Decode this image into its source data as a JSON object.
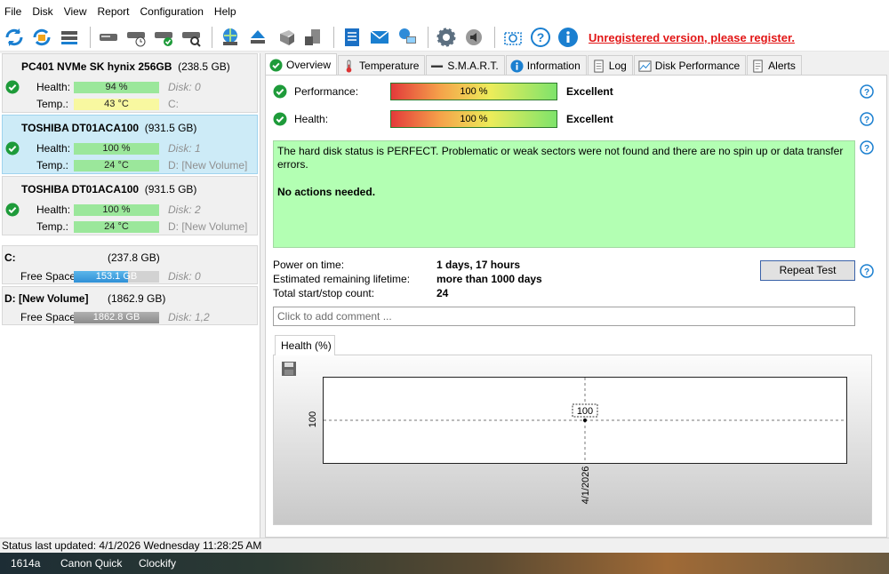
{
  "menu": [
    "File",
    "Disk",
    "View",
    "Report",
    "Configuration",
    "Help"
  ],
  "register_link": "Unregistered version, please register.",
  "disks": [
    {
      "name": "PC401 NVMe SK hynix 256GB",
      "size": "(238.5 GB)",
      "health": "94 %",
      "health_pct": 94,
      "temp": "43 °C",
      "temp_pct": 100,
      "disk_no": "Disk: 0",
      "drive": "C:",
      "selected": false
    },
    {
      "name": "TOSHIBA DT01ACA100",
      "size": "(931.5 GB)",
      "health": "100 %",
      "health_pct": 100,
      "temp": "24 °C",
      "temp_pct": 100,
      "disk_no": "Disk: 1",
      "drive": "D: [New Volume]",
      "selected": true
    },
    {
      "name": "TOSHIBA DT01ACA100",
      "size": "(931.5 GB)",
      "health": "100 %",
      "health_pct": 100,
      "temp": "24 °C",
      "temp_pct": 100,
      "disk_no": "Disk: 2",
      "drive": "D: [New Volume]",
      "selected": false
    }
  ],
  "disk_labels": {
    "health": "Health:",
    "temp": "Temp.:"
  },
  "partitions": [
    {
      "name": "C:",
      "size": "(237.8 GB)",
      "free_label": "Free Space",
      "free": "153.1 GB",
      "free_pct": 64,
      "disk": "Disk: 0"
    },
    {
      "name": "D: [New Volume]",
      "size": "(1862.9 GB)",
      "free_label": "Free Space",
      "free": "1862.8 GB",
      "free_pct": 100,
      "disk": "Disk: 1,2"
    }
  ],
  "tabs": [
    "Overview",
    "Temperature",
    "S.M.A.R.T.",
    "Information",
    "Log",
    "Disk Performance",
    "Alerts"
  ],
  "overview": {
    "performance_label": "Performance:",
    "performance_value": "100 %",
    "performance_verdict": "Excellent",
    "health_label": "Health:",
    "health_value": "100 %",
    "health_verdict": "Excellent",
    "status_text": "The hard disk status is PERFECT. Problematic or weak sectors were not found and there are no spin up or data transfer errors.",
    "actions_text": "No actions needed.",
    "power_on_label": "Power on time:",
    "power_on_value": "1 days, 17 hours",
    "lifetime_label": "Estimated remaining lifetime:",
    "lifetime_value": "more than 1000 days",
    "startstop_label": "Total start/stop count:",
    "startstop_value": "24",
    "repeat_button": "Repeat Test",
    "comment_placeholder": "Click to add comment ..."
  },
  "chart_tab": "Health (%)",
  "chart_data": {
    "type": "line",
    "x": [
      "4/1/2026"
    ],
    "series": [
      {
        "values": [
          100
        ]
      }
    ],
    "xlabel": "",
    "ylabel": "",
    "y_tick_labels": [
      "100"
    ],
    "x_tick_labels": [
      "4/1/2026"
    ],
    "data_labels": [
      "100"
    ]
  },
  "statusbar": "Status last updated: 4/1/2026 Wednesday 11:28:25 AM",
  "taskbar": [
    "1614a",
    "Canon Quick",
    "Clockify"
  ],
  "colors": {
    "register": "#e21616",
    "ok_green": "#1e9b3a",
    "status_bg": "#b3ffb3",
    "selected_row": "#cdebf7"
  }
}
